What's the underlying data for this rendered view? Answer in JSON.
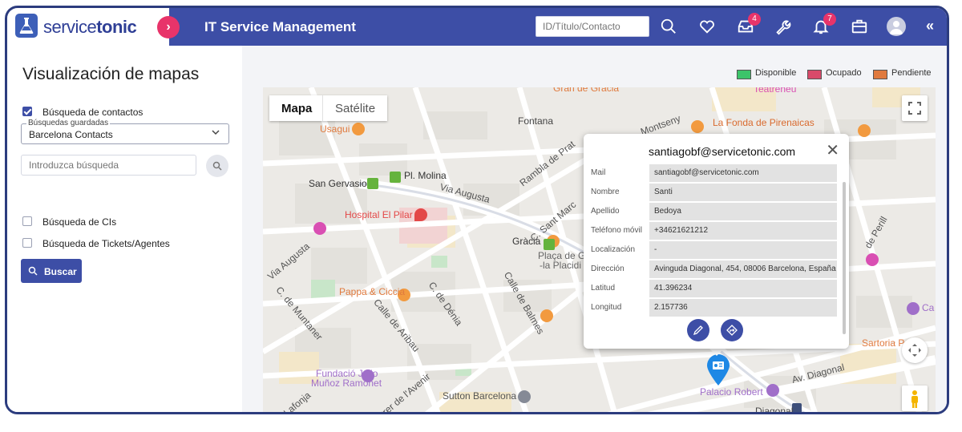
{
  "header": {
    "logo_text_light": "service",
    "logo_text_bold": "tonic",
    "app_title": "IT Service Management",
    "search_placeholder": "ID/Título/Contacto",
    "icons": [
      "search-icon",
      "heart-icon",
      "inbox-icon",
      "wrench-icon",
      "bell-icon",
      "briefcase-icon",
      "avatar",
      "double-chevron-left-icon"
    ],
    "inbox_badge": "4",
    "bell_badge": "7"
  },
  "sidebar": {
    "title": "Visualización de mapas",
    "contacts_check_label": "Búsqueda de contactos",
    "contacts_checked": true,
    "saved_legend": "Búsquedas guardadas",
    "saved_value": "Barcelona Contacts",
    "search_placeholder": "Introduzca búsqueda",
    "cis_label": "Búsqueda de CIs",
    "tickets_label": "Búsqueda de Tickets/Agentes",
    "buscar_label": "Buscar"
  },
  "legend": {
    "items": [
      {
        "label": "Disponible",
        "color": "#3cc46a"
      },
      {
        "label": "Ocupado",
        "color": "#d94a6a"
      },
      {
        "label": "Pendiente",
        "color": "#e07a3e"
      }
    ]
  },
  "map": {
    "tab_map": "Mapa",
    "tab_satellite": "Satélite",
    "labels": {
      "usagui": "Usagui",
      "fontana": "Fontana",
      "la_fonda": "La Fonda de Pirenaicas",
      "san_gervasio": "San Gervasio",
      "pl_molina": "Pl. Molina",
      "via_augusta": "Via Augusta",
      "hospital": "Hospital El Pilar",
      "gracia": "Gràcia",
      "placa": "Plaça de Gal",
      "placa2": "-la Placidi",
      "pappa": "Pappa & Ciccia",
      "fundacio1": "Fundació Julio",
      "fundacio2": "Muñoz Ramonet",
      "sutton": "Sutton Barcelona",
      "palacio": "Palacio Robert",
      "diagonal": "Diagonal",
      "av_diagonal": "Av. Diagonal",
      "sartoria": "Sartoria Pane",
      "calle_balmes": "Calle de Balmes",
      "rambla": "Rambla de Prat",
      "monteny": "Montseny",
      "c_sant_marc": "C. Sant Marc",
      "c_denia": "C. de Dénia",
      "calle_aribau": "Calle de Aribau",
      "muntaner": "C. de Muntaner",
      "carrer_avenir": "Carrer de l'Avenir",
      "lafonja": "Lafonja",
      "teatreneu": "Teatreneu",
      "gran_gracia": "Gran de Gràcia",
      "perill": "de Perill",
      "ca": "Ca",
      "via_augusta2": "Via Augusta"
    }
  },
  "popup": {
    "title": "santiagobf@servicetonic.com",
    "rows": [
      {
        "label": "Mail",
        "value": "santiagobf@servicetonic.com"
      },
      {
        "label": "Nombre",
        "value": "Santi"
      },
      {
        "label": "Apellido",
        "value": "Bedoya"
      },
      {
        "label": "Teléfono móvil",
        "value": "+34621621212"
      },
      {
        "label": "Localización",
        "value": "-"
      },
      {
        "label": "Dirección",
        "value": "Avinguda Diagonal, 454, 08006 Barcelona, España"
      },
      {
        "label": "Latitud",
        "value": "41.396234"
      },
      {
        "label": "Longitud",
        "value": "2.157736"
      }
    ]
  }
}
